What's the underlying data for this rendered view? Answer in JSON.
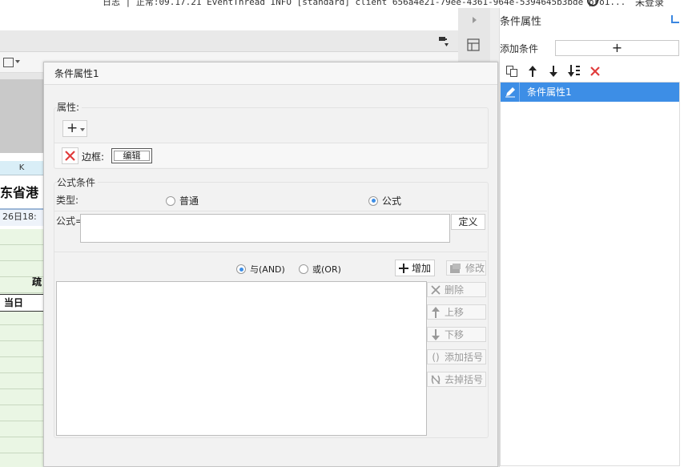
{
  "topbar": {
    "log_text": "日志 | 正常:09.17.21 EventThread INFO [standard] client 656a4e21-79ee-4361-964e-5394645b3bde pro1...",
    "login": "未登录"
  },
  "sheet": {
    "col_header": "K",
    "title_fragment": "东省港",
    "date_fragment": "26日18:",
    "cell_fragment": "疏",
    "cell_day": "当日"
  },
  "right_panel": {
    "title": "条件属性",
    "add_label": "添加条件",
    "add_symbol": "+",
    "items": [
      "条件属性1"
    ]
  },
  "dialog": {
    "title": "条件属性1",
    "attr_group_label": "属性:",
    "add_symbol": "+",
    "border_label": "边框:",
    "edit_label": "编辑",
    "formula_group_label": "公式条件",
    "type_label": "类型:",
    "type_options": [
      {
        "label": "普通",
        "selected": false
      },
      {
        "label": "公式",
        "selected": true
      }
    ],
    "formula_label": "公式=",
    "formula_value": "",
    "define_label": "定义",
    "logic_options": [
      {
        "label": "与(AND)",
        "selected": true
      },
      {
        "label": "或(OR)",
        "selected": false
      }
    ],
    "add_label": "增加",
    "modify_label": "修改",
    "delete_label": "删除",
    "up_label": "上移",
    "down_label": "下移",
    "add_bracket_label": "添加括号",
    "remove_bracket_label": "去掉括号"
  },
  "colors": {
    "accent": "#3d8ee6",
    "delete_red": "#e03c3c"
  }
}
